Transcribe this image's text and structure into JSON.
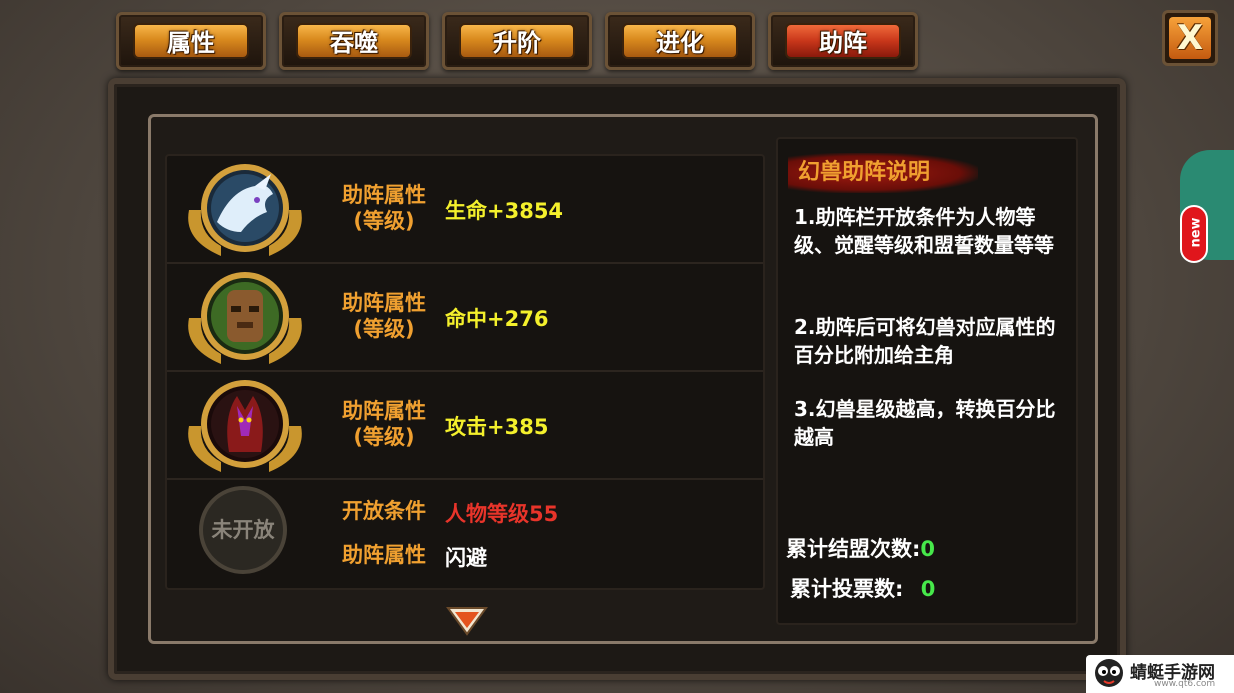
{
  "tabs": [
    {
      "label": "属性",
      "active": false
    },
    {
      "label": "吞噬",
      "active": false
    },
    {
      "label": "升阶",
      "active": false
    },
    {
      "label": "进化",
      "active": false
    },
    {
      "label": "助阵",
      "active": true
    }
  ],
  "close_label": "X",
  "slots": [
    {
      "icon": "ice-dragon-icon",
      "label_line1": "助阵属性",
      "label_line2": "(等级)",
      "value": "生命+3854"
    },
    {
      "icon": "treant-icon",
      "label_line1": "助阵属性",
      "label_line2": "(等级)",
      "value": "命中+276"
    },
    {
      "icon": "fire-dragon-icon",
      "label_line1": "助阵属性",
      "label_line2": "(等级)",
      "value": "攻击+385"
    }
  ],
  "locked_slot": {
    "badge": "未开放",
    "condition_label": "开放条件",
    "condition_value": "人物等级55",
    "attr_label": "助阵属性",
    "attr_value": "闪避"
  },
  "description": {
    "title": "幻兽助阵说明",
    "p1": "1.助阵栏开放条件为人物等级、觉醒等级和盟誓数量等等",
    "p2": "2.助阵后可将幻兽对应属性的百分比附加给主角",
    "p3": "3.幻兽星级越高，转换百分比越高"
  },
  "stats": {
    "alliance_label": "累计结盟次数:",
    "alliance_value": "0",
    "vote_label": "累计投票数:",
    "vote_value": "0"
  },
  "side_badge": "new",
  "watermark": {
    "text": "蜻蜓手游网",
    "url": "www.qt6.com"
  },
  "colors": {
    "label_orange": "#f0a030",
    "value_yellow": "#f4f02c",
    "condition_red": "#e8342a",
    "count_green": "#46e84a",
    "tab_active": "#c8361a"
  }
}
